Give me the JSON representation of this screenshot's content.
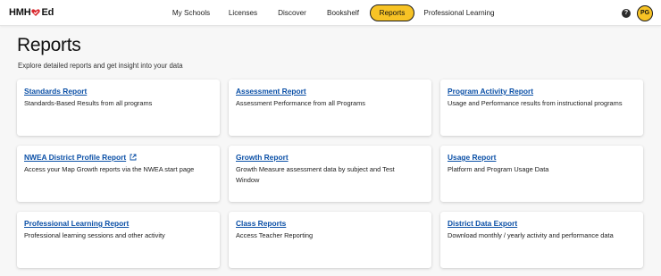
{
  "header": {
    "logo_text_left": "HMH",
    "logo_text_right": "Ed",
    "nav": [
      {
        "label": "My Schools",
        "active": false
      },
      {
        "label": "Licenses",
        "active": false
      },
      {
        "label": "Discover",
        "active": false
      },
      {
        "label": "Bookshelf",
        "active": false
      },
      {
        "label": "Reports",
        "active": true
      },
      {
        "label": "Professional Learning",
        "active": false
      }
    ],
    "help_icon": "question-circle-icon",
    "help_glyph": "?",
    "avatar_initials": "PG",
    "accent_color": "#f7c325",
    "logo_heart_color": "#d9262c"
  },
  "page": {
    "title": "Reports",
    "subtitle": "Explore detailed reports and get insight into your data",
    "link_color": "#0a4fa6"
  },
  "cards": [
    {
      "title": "Standards Report",
      "desc": "Standards-Based Results from all programs"
    },
    {
      "title": "Assessment Report",
      "desc": "Assessment Performance from all Programs"
    },
    {
      "title": "Program Activity Report",
      "desc": "Usage and Performance results from instructional programs"
    },
    {
      "title": "NWEA District Profile Report",
      "desc": "Access your Map Growth reports via the NWEA start page",
      "external": true
    },
    {
      "title": "Growth Report",
      "desc": "Growth Measure assessment data by subject and Test Window"
    },
    {
      "title": "Usage Report",
      "desc": "Platform and Program Usage Data"
    },
    {
      "title": "Professional Learning Report",
      "desc": "Professional learning sessions and other activity"
    },
    {
      "title": "Class Reports",
      "desc": "Access Teacher Reporting"
    },
    {
      "title": "District Data Export",
      "desc": "Download monthly / yearly activity and performance data"
    }
  ]
}
